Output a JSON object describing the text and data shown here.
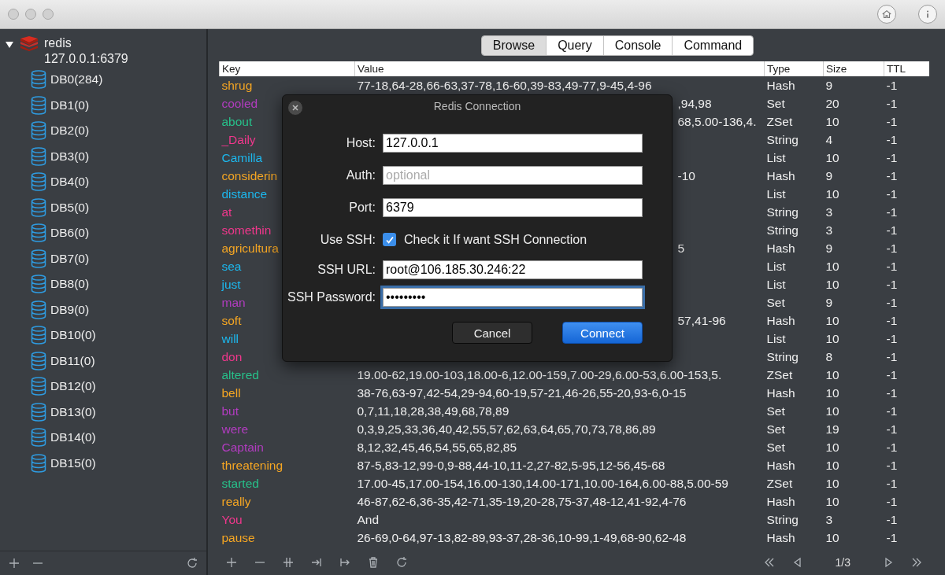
{
  "sidebar": {
    "server": {
      "name": "redis",
      "address": "127.0.0.1:6379",
      "expanded": true,
      "children": [
        {
          "label": "DB0(284)"
        },
        {
          "label": "DB1(0)"
        },
        {
          "label": "DB2(0)"
        },
        {
          "label": "DB3(0)"
        },
        {
          "label": "DB4(0)"
        },
        {
          "label": "DB5(0)"
        },
        {
          "label": "DB6(0)"
        },
        {
          "label": "DB7(0)"
        },
        {
          "label": "DB8(0)"
        },
        {
          "label": "DB9(0)"
        },
        {
          "label": "DB10(0)"
        },
        {
          "label": "DB11(0)"
        },
        {
          "label": "DB12(0)"
        },
        {
          "label": "DB13(0)"
        },
        {
          "label": "DB14(0)"
        },
        {
          "label": "DB15(0)"
        }
      ]
    }
  },
  "tabs": [
    {
      "label": "Browse",
      "selected": true
    },
    {
      "label": "Query",
      "selected": false
    },
    {
      "label": "Console",
      "selected": false
    },
    {
      "label": "Command",
      "selected": false
    }
  ],
  "table": {
    "columns": [
      "Key",
      "Value",
      "Type",
      "Size",
      "TTL"
    ],
    "rows": [
      {
        "key": "shrug",
        "color": "#f5a623",
        "value": "77-18,64-28,66-63,37-78,16-60,39-83,49-77,9-45,4-96",
        "type": "Hash",
        "size": "9",
        "ttl": "-1"
      },
      {
        "key": "cooled",
        "color": "#b23cc0",
        "value": ",94,98",
        "type": "Set",
        "size": "20",
        "ttl": "-1",
        "under_dialog": true
      },
      {
        "key": "about",
        "color": "#27c08a",
        "value": "68,5.00-136,4.",
        "type": "ZSet",
        "size": "10",
        "ttl": "-1",
        "under_dialog": true
      },
      {
        "key": "_Daily",
        "color": "#f0378c",
        "type": "String",
        "size": "4",
        "ttl": "-1"
      },
      {
        "key": "Camilla",
        "color": "#1cb8ee",
        "type": "List",
        "size": "10",
        "ttl": "-1"
      },
      {
        "key": "considerin",
        "color": "#f5a623",
        "value": "-10",
        "type": "Hash",
        "size": "9",
        "ttl": "-1",
        "under_dialog": true
      },
      {
        "key": "distance",
        "color": "#1cb8ee",
        "type": "List",
        "size": "10",
        "ttl": "-1"
      },
      {
        "key": "at",
        "color": "#f0378c",
        "type": "String",
        "size": "3",
        "ttl": "-1"
      },
      {
        "key": "somethin",
        "color": "#f0378c",
        "type": "String",
        "size": "3",
        "ttl": "-1"
      },
      {
        "key": "agricultura",
        "color": "#f5a623",
        "value": "5",
        "type": "Hash",
        "size": "9",
        "ttl": "-1",
        "under_dialog": true
      },
      {
        "key": "sea",
        "color": "#1cb8ee",
        "type": "List",
        "size": "10",
        "ttl": "-1"
      },
      {
        "key": "just",
        "color": "#1cb8ee",
        "type": "List",
        "size": "10",
        "ttl": "-1"
      },
      {
        "key": "man",
        "color": "#b23cc0",
        "type": "Set",
        "size": "9",
        "ttl": "-1"
      },
      {
        "key": "soft",
        "color": "#f5a623",
        "value": "57,41-96",
        "type": "Hash",
        "size": "10",
        "ttl": "-1",
        "under_dialog": true
      },
      {
        "key": "will",
        "color": "#1cb8ee",
        "type": "List",
        "size": "10",
        "ttl": "-1"
      },
      {
        "key": "don",
        "color": "#f0378c",
        "type": "String",
        "size": "8",
        "ttl": "-1"
      },
      {
        "key": "altered",
        "color": "#27c08a",
        "value": "19.00-62,19.00-103,18.00-6,12.00-159,7.00-29,6.00-53,6.00-153,5.",
        "type": "ZSet",
        "size": "10",
        "ttl": "-1"
      },
      {
        "key": "bell",
        "color": "#f5a623",
        "value": "38-76,63-97,42-54,29-94,60-19,57-21,46-26,55-20,93-6,0-15",
        "type": "Hash",
        "size": "10",
        "ttl": "-1"
      },
      {
        "key": "but",
        "color": "#b23cc0",
        "value": "0,7,11,18,28,38,49,68,78,89",
        "type": "Set",
        "size": "10",
        "ttl": "-1"
      },
      {
        "key": "were",
        "color": "#b23cc0",
        "value": "0,3,9,25,33,36,40,42,55,57,62,63,64,65,70,73,78,86,89",
        "type": "Set",
        "size": "19",
        "ttl": "-1"
      },
      {
        "key": "Captain",
        "color": "#b23cc0",
        "value": "8,12,32,45,46,54,55,65,82,85",
        "type": "Set",
        "size": "10",
        "ttl": "-1"
      },
      {
        "key": "threatening",
        "color": "#f5a623",
        "value": "87-5,83-12,99-0,9-88,44-10,11-2,27-82,5-95,12-56,45-68",
        "type": "Hash",
        "size": "10",
        "ttl": "-1"
      },
      {
        "key": "started",
        "color": "#27c08a",
        "value": "17.00-45,17.00-154,16.00-130,14.00-171,10.00-164,6.00-88,5.00-59",
        "type": "ZSet",
        "size": "10",
        "ttl": "-1"
      },
      {
        "key": "really",
        "color": "#f5a623",
        "value": "46-87,62-6,36-35,42-71,35-19,20-28,75-37,48-12,41-92,4-76",
        "type": "Hash",
        "size": "10",
        "ttl": "-1"
      },
      {
        "key": "You",
        "color": "#f0378c",
        "value": "And",
        "type": "String",
        "size": "3",
        "ttl": "-1"
      },
      {
        "key": "pause",
        "color": "#f5a623",
        "value": "26-69,0-64,97-13,82-89,93-37,28-36,10-99,1-49,68-90,62-48",
        "type": "Hash",
        "size": "10",
        "ttl": "-1"
      }
    ]
  },
  "pager": {
    "page": "1/3"
  },
  "dialog": {
    "title": "Redis Connection",
    "fields": [
      {
        "label": "Host:",
        "kind": "text",
        "value": "127.0.0.1"
      },
      {
        "label": "Auth:",
        "kind": "text",
        "placeholder": "optional"
      },
      {
        "label": "Port:",
        "kind": "text",
        "value": "6379"
      },
      {
        "label": "Use SSH:",
        "kind": "checkbox",
        "checked": true,
        "text": "Check it If want SSH  Connection"
      },
      {
        "label": "SSH URL:",
        "kind": "text",
        "value": "root@106.185.30.246:22"
      },
      {
        "label": "SSH Password:",
        "kind": "password",
        "value": "•••••••••",
        "focused": true
      }
    ],
    "buttons": [
      {
        "label": "Cancel",
        "kind": "secondary"
      },
      {
        "label": "Connect",
        "kind": "primary"
      }
    ]
  }
}
